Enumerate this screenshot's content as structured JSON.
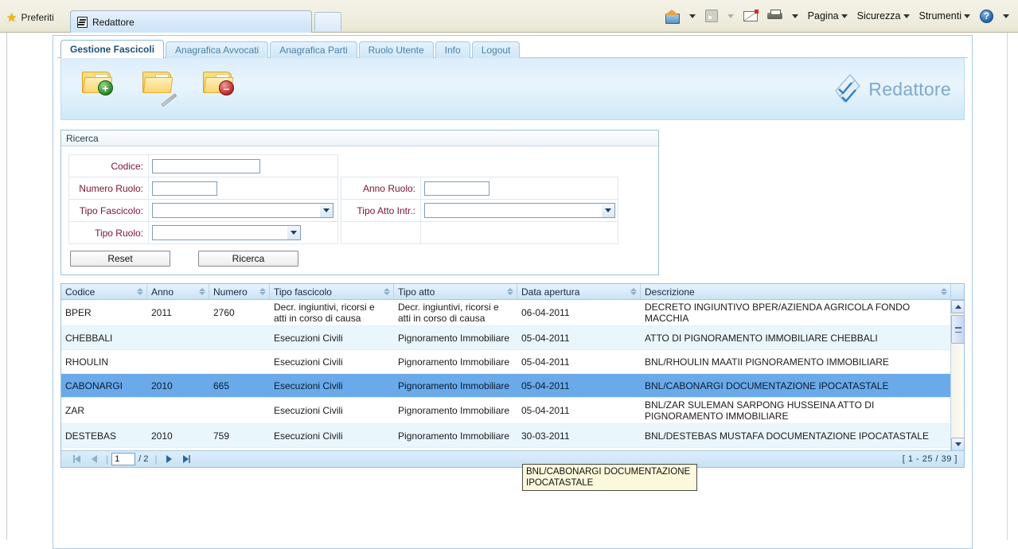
{
  "browser": {
    "favorites_label": "Preferiti",
    "favorites_icon": "star-icon",
    "tab_title": "Redattore",
    "tools": [
      {
        "icon": "home-icon",
        "label": ""
      },
      {
        "icon": "rss-icon",
        "label": ""
      },
      {
        "icon": "mail-icon",
        "label": ""
      },
      {
        "icon": "print-icon",
        "label": ""
      },
      {
        "icon": "",
        "label": "Pagina"
      },
      {
        "icon": "",
        "label": "Sicurezza"
      },
      {
        "icon": "",
        "label": "Strumenti"
      },
      {
        "icon": "help-icon",
        "label": ""
      }
    ],
    "page_label": "Pagina",
    "security_label": "Sicurezza",
    "tools_label": "Strumenti",
    "help_glyph": "?"
  },
  "app": {
    "brand": "Redattore",
    "tabs": [
      {
        "label": "Gestione Fascicoli",
        "active": true
      },
      {
        "label": "Anagrafica Avvocati",
        "active": false
      },
      {
        "label": "Anagrafica Parti",
        "active": false
      },
      {
        "label": "Ruolo Utente",
        "active": false
      },
      {
        "label": "Info",
        "active": false
      },
      {
        "label": "Logout",
        "active": false
      }
    ],
    "toolbar_buttons": [
      {
        "name": "new-fascicolo-icon",
        "badge": "+"
      },
      {
        "name": "edit-fascicolo-icon",
        "badge": ""
      },
      {
        "name": "delete-fascicolo-icon",
        "badge": "–"
      }
    ]
  },
  "search": {
    "title": "Ricerca",
    "fields": {
      "codice_label": "Codice:",
      "codice_value": "",
      "numero_ruolo_label": "Numero Ruolo:",
      "numero_ruolo_value": "",
      "anno_ruolo_label": "Anno Ruolo:",
      "anno_ruolo_value": "",
      "tipo_fascicolo_label": "Tipo Fascicolo:",
      "tipo_fascicolo_value": "",
      "tipo_atto_label": "Tipo Atto Intr.:",
      "tipo_atto_value": "",
      "tipo_ruolo_label": "Tipo Ruolo:",
      "tipo_ruolo_value": ""
    },
    "reset_label": "Reset",
    "search_label": "Ricerca"
  },
  "grid": {
    "columns": [
      {
        "label": "Codice",
        "sortable": true
      },
      {
        "label": "Anno",
        "sortable": true
      },
      {
        "label": "Numero",
        "sortable": true
      },
      {
        "label": "Tipo fascicolo",
        "sortable": true
      },
      {
        "label": "Tipo atto",
        "sortable": true
      },
      {
        "label": "Data apertura",
        "sortable": true
      },
      {
        "label": "Descrizione",
        "sortable": true
      }
    ],
    "rows": [
      {
        "codice": "BPER",
        "anno": "2011",
        "numero": "2760",
        "tipo_fascicolo": "Decr. ingiuntivi, ricorsi e atti in corso di causa",
        "tipo_atto": "Decr. ingiuntivi, ricorsi e atti in corso di causa",
        "data_apertura": "06-04-2011",
        "descrizione": "DECRETO INGIUNTIVO BPER/AZIENDA AGRICOLA FONDO MACCHIA",
        "state": "normal"
      },
      {
        "codice": "CHEBBALI",
        "anno": "",
        "numero": "",
        "tipo_fascicolo": "Esecuzioni Civili",
        "tipo_atto": "Pignoramento Immobiliare",
        "data_apertura": "05-04-2011",
        "descrizione": "ATTO DI PIGNORAMENTO IMMOBILIARE CHEBBALI",
        "state": "alt"
      },
      {
        "codice": "RHOULIN",
        "anno": "",
        "numero": "",
        "tipo_fascicolo": "Esecuzioni Civili",
        "tipo_atto": "Pignoramento Immobiliare",
        "data_apertura": "05-04-2011",
        "descrizione": "BNL/RHOULIN MAATII PIGNORAMENTO IMMOBILIARE",
        "state": "normal"
      },
      {
        "codice": "CABONARGI",
        "anno": "2010",
        "numero": "665",
        "tipo_fascicolo": "Esecuzioni Civili",
        "tipo_atto": "Pignoramento Immobiliare",
        "data_apertura": "05-04-2011",
        "descrizione": "BNL/CABONARGI DOCUMENTAZIONE IPOCATASTALE",
        "state": "selected"
      },
      {
        "codice": "ZAR",
        "anno": "",
        "numero": "",
        "tipo_fascicolo": "Esecuzioni Civili",
        "tipo_atto": "Pignoramento Immobiliare",
        "data_apertura": "05-04-2011",
        "descrizione": "BNL/ZAR SULEMAN SARPONG HUSSEINA ATTO DI PIGNORAMENTO IMMOBILIARE",
        "state": "normal"
      },
      {
        "codice": "DESTEBAS",
        "anno": "2010",
        "numero": "759",
        "tipo_fascicolo": "Esecuzioni Civili",
        "tipo_atto": "Pignoramento Immobiliare",
        "data_apertura": "30-03-2011",
        "descrizione": "BNL/DESTEBAS MUSTAFA DOCUMENTAZIONE IPOCATASTALE",
        "state": "alt"
      }
    ],
    "tooltip": "BNL/CABONARGI DOCUMENTAZIONE IPOCATASTALE",
    "pager": {
      "current_page": "1",
      "separator": "/",
      "total_pages": "2",
      "range": "[ 1 - 25 / 39 ]"
    }
  },
  "colors": {
    "selection_blue": "#6aaaea",
    "header_blue": "#c9e3f6",
    "label_maroon": "#7a1432",
    "tooltip_bg": "#fbf8dc",
    "brand_text": "#7fa9cc"
  }
}
